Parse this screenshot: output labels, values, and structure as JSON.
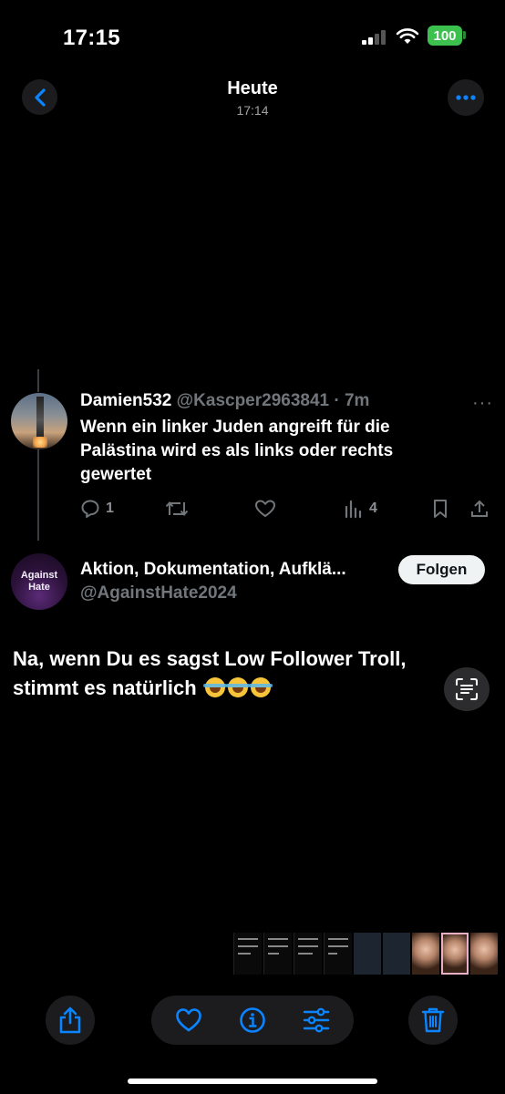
{
  "status_bar": {
    "time": "17:15",
    "battery": "100"
  },
  "header": {
    "title": "Heute",
    "subtitle": "17:14"
  },
  "tweet": {
    "name": "Damien532",
    "handle_time": "@Kascper2963841 · 7m",
    "body": "Wenn ein linker Juden angreift für die Palästina wird es als links oder rechts gewertet",
    "replies": "1",
    "views": "4",
    "more": "···"
  },
  "reply": {
    "avatar_text_1": "Against",
    "avatar_text_2": "Hate",
    "name": "Aktion, Dokumentation, Aufklä...",
    "handle": "@AgainstHate2024",
    "follow_label": "Folgen",
    "body": "Na, wenn Du es sagst Low Follower Troll, stimmt es natürlich"
  },
  "icons": {
    "back": "chevron-left-icon",
    "more": "ellipsis-icon",
    "share": "share-icon",
    "favorite": "heart-icon",
    "info": "info-icon",
    "adjust": "sliders-icon",
    "delete": "trash-icon",
    "live_text": "live-text-icon"
  },
  "colors": {
    "accent": "#0a84ff",
    "battery": "#3cc04e",
    "muted": "#71767b"
  }
}
